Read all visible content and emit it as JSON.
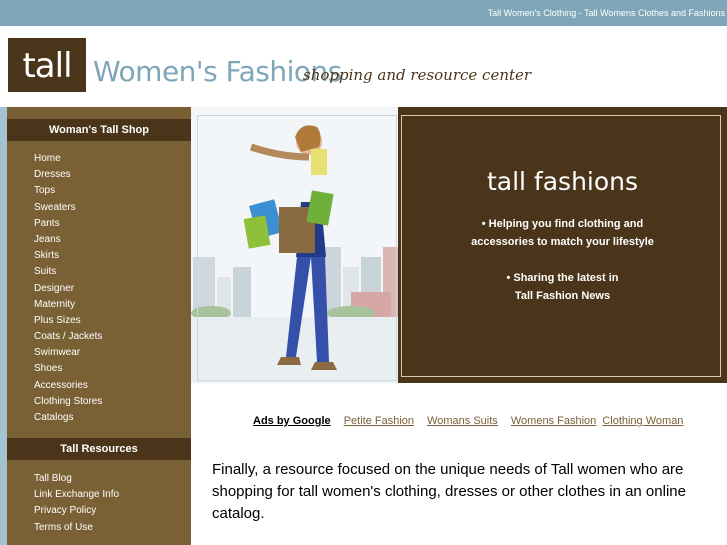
{
  "topbar": {
    "link": "Tall Women's Clothing - Tall Womens Clothes and Fashions"
  },
  "header": {
    "logo": "tall",
    "brand": "Women's Fashions",
    "tagline": "shopping and resource center"
  },
  "sidebar": {
    "shop_heading": "Woman's Tall Shop",
    "shop_items": [
      "Home",
      "Dresses",
      "Tops",
      "Sweaters",
      "Pants",
      "Jeans",
      "Skirts",
      "Suits",
      "Designer",
      "Maternity",
      "Plus Sizes",
      "Coats / Jackets",
      "Swimwear",
      "Shoes",
      "Accessories",
      "Clothing Stores",
      "Catalogs"
    ],
    "resources_heading": "Tall Resources",
    "resource_items": [
      "Tall Blog",
      "Link Exchange Info",
      "Privacy Policy",
      "Terms of Use"
    ]
  },
  "hero": {
    "title": "tall fashions",
    "bullet1_line1": "•  Helping you find clothing and",
    "bullet1_line2": "accessories to match your lifestyle",
    "bullet2_line1": "•  Sharing the latest in",
    "bullet2_line2": "Tall Fashion News"
  },
  "ads": {
    "label": "Ads by Google",
    "links": [
      "Petite Fashion",
      "Womans Suits",
      "Womens Fashion",
      "Clothing Woman"
    ]
  },
  "intro": "Finally, a resource focused on the unique needs of Tall women who are shopping for tall women's clothing, dresses or other clothes in an online catalog.",
  "colors": {
    "brown": "#4a351a",
    "sidebar": "#7a6035",
    "blue": "#7fa6b8"
  }
}
